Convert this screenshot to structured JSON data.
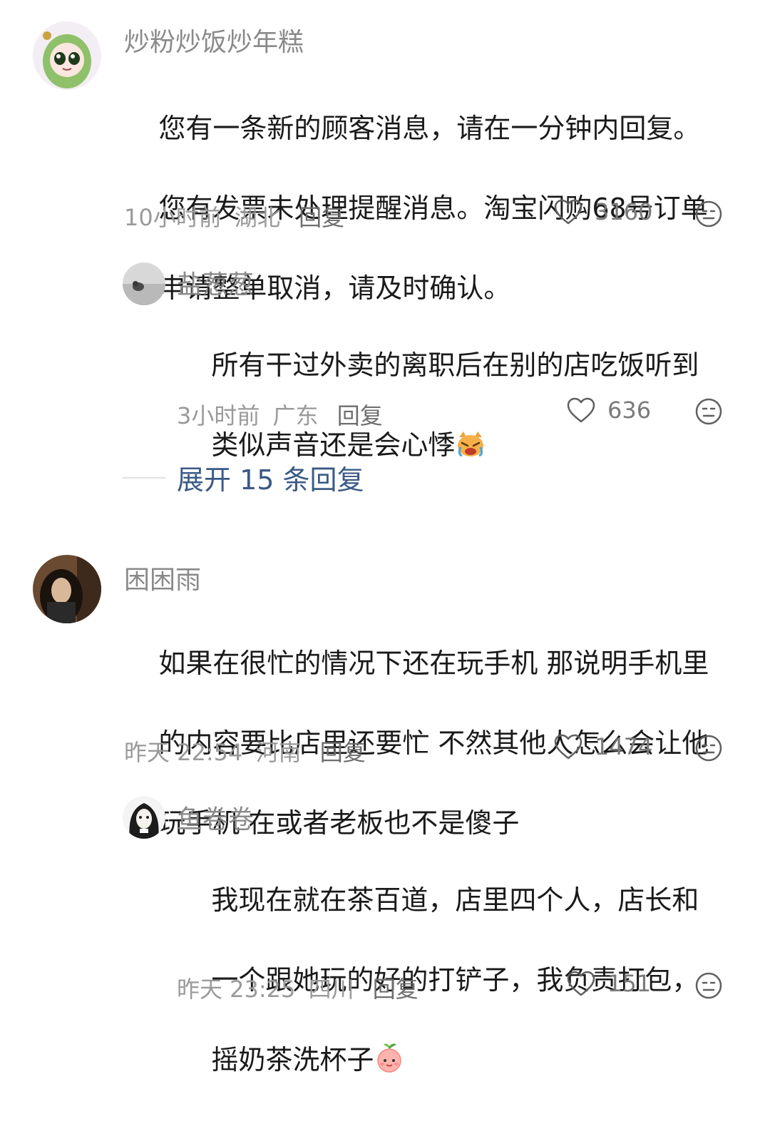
{
  "comments": [
    {
      "username": "炒粉炒饭炒年糕",
      "lines": [
        "您有一条新的顾客消息，请在一分钟内回复。",
        "您有发票未处理提醒消息。淘宝闪购68号订单",
        "申请整单取消，请及时确认。"
      ],
      "time": "10小时前",
      "location": "湖北",
      "reply_label": "回复",
      "likes": "3160",
      "avatar_icon": "green-cartoon-girl-avatar"
    },
    {
      "username": "盐葱葱",
      "lines": [
        "所有干过外卖的离职后在别的店吃饭听到",
        "类似声音还是会心悸"
      ],
      "emoji": "crying-cat-emoji",
      "time": "3小时前",
      "location": "广东",
      "reply_label": "回复",
      "likes": "636",
      "avatar_icon": "grey-cat-photo-avatar"
    },
    {
      "username": "困困雨",
      "lines": [
        "如果在很忙的情况下还在玩手机 那说明手机里",
        "的内容要比店里还要忙 不然其他人怎么会让他",
        "玩手机 在或者老板也不是傻子"
      ],
      "time": "昨天 22:54",
      "location": "河南",
      "reply_label": "回复",
      "likes": "1474",
      "avatar_icon": "dark-hair-person-photo-avatar"
    },
    {
      "username": "鱼卷卷",
      "lines": [
        "我现在就在茶百道，店里四个人，店长和",
        "一个跟她玩的好的打铲子，我负责打包，",
        "摇奶茶洗杯子"
      ],
      "emoji": "peach-emoji",
      "time": "昨天 23:25",
      "location": "四川",
      "reply_label": "回复",
      "likes": "151",
      "avatar_icon": "sketch-girl-avatar"
    }
  ],
  "expand": {
    "label": "展开 15 条回复"
  },
  "colors": {
    "accent": "#3a5a86",
    "meta": "#9a9a9a",
    "text": "#1a1a1a"
  }
}
